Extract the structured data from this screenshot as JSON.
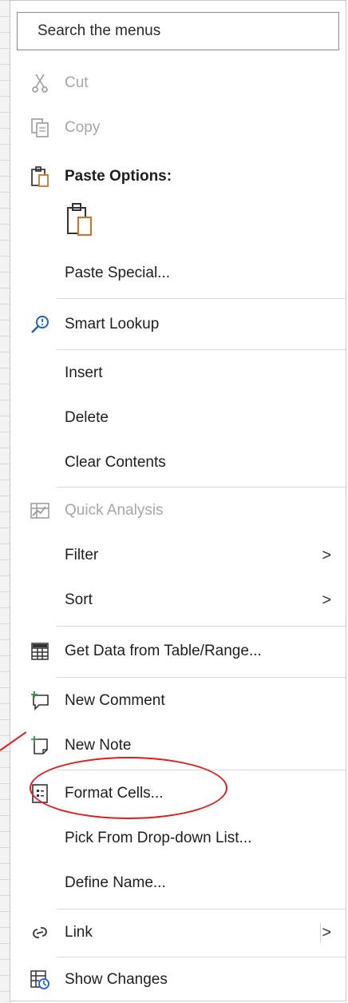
{
  "menu": {
    "search_placeholder": "Search the menus",
    "items": {
      "cut": "Cut",
      "copy": "Copy",
      "paste_options": "Paste Options:",
      "paste_special": "Paste Special...",
      "smart_lookup": "Smart Lookup",
      "insert": "Insert",
      "delete": "Delete",
      "clear_contents": "Clear Contents",
      "quick_analysis": "Quick Analysis",
      "filter": "Filter",
      "sort": "Sort",
      "get_data": "Get Data from Table/Range...",
      "new_comment": "New Comment",
      "new_note": "New Note",
      "format_cells": "Format Cells...",
      "pick_list": "Pick From Drop-down List...",
      "define_name": "Define Name...",
      "link": "Link",
      "show_changes": "Show Changes"
    },
    "submenu_glyph": ">"
  },
  "icons": {
    "cut": "scissors-icon",
    "copy": "copy-icon",
    "paste": "clipboard-icon",
    "smart_lookup": "search-icon",
    "quick_analysis": "quick-analysis-icon",
    "get_data": "table-icon",
    "new_comment": "comment-icon",
    "new_note": "note-icon",
    "format_cells": "format-cells-icon",
    "link": "link-icon",
    "show_changes": "show-changes-icon"
  },
  "colors": {
    "annotation": "#e31b1b",
    "paste_icon_accent": "#c27a2c",
    "lookup_icon": "#1a63c4",
    "note_plus": "#2f9e44"
  }
}
